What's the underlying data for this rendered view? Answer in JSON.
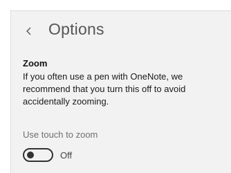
{
  "header": {
    "title": "Options",
    "back_icon": "chevron-left-icon"
  },
  "zoom": {
    "heading": "Zoom",
    "description": "If you often use a pen with OneNote, we recommend that you turn this off to avoid accidentally zooming.",
    "toggle": {
      "label": "Use touch to zoom",
      "state": "Off",
      "on": false
    }
  },
  "colors": {
    "panel_bg": "#f2f2f2",
    "title_text": "#555555",
    "toggle_border": "#333333"
  }
}
